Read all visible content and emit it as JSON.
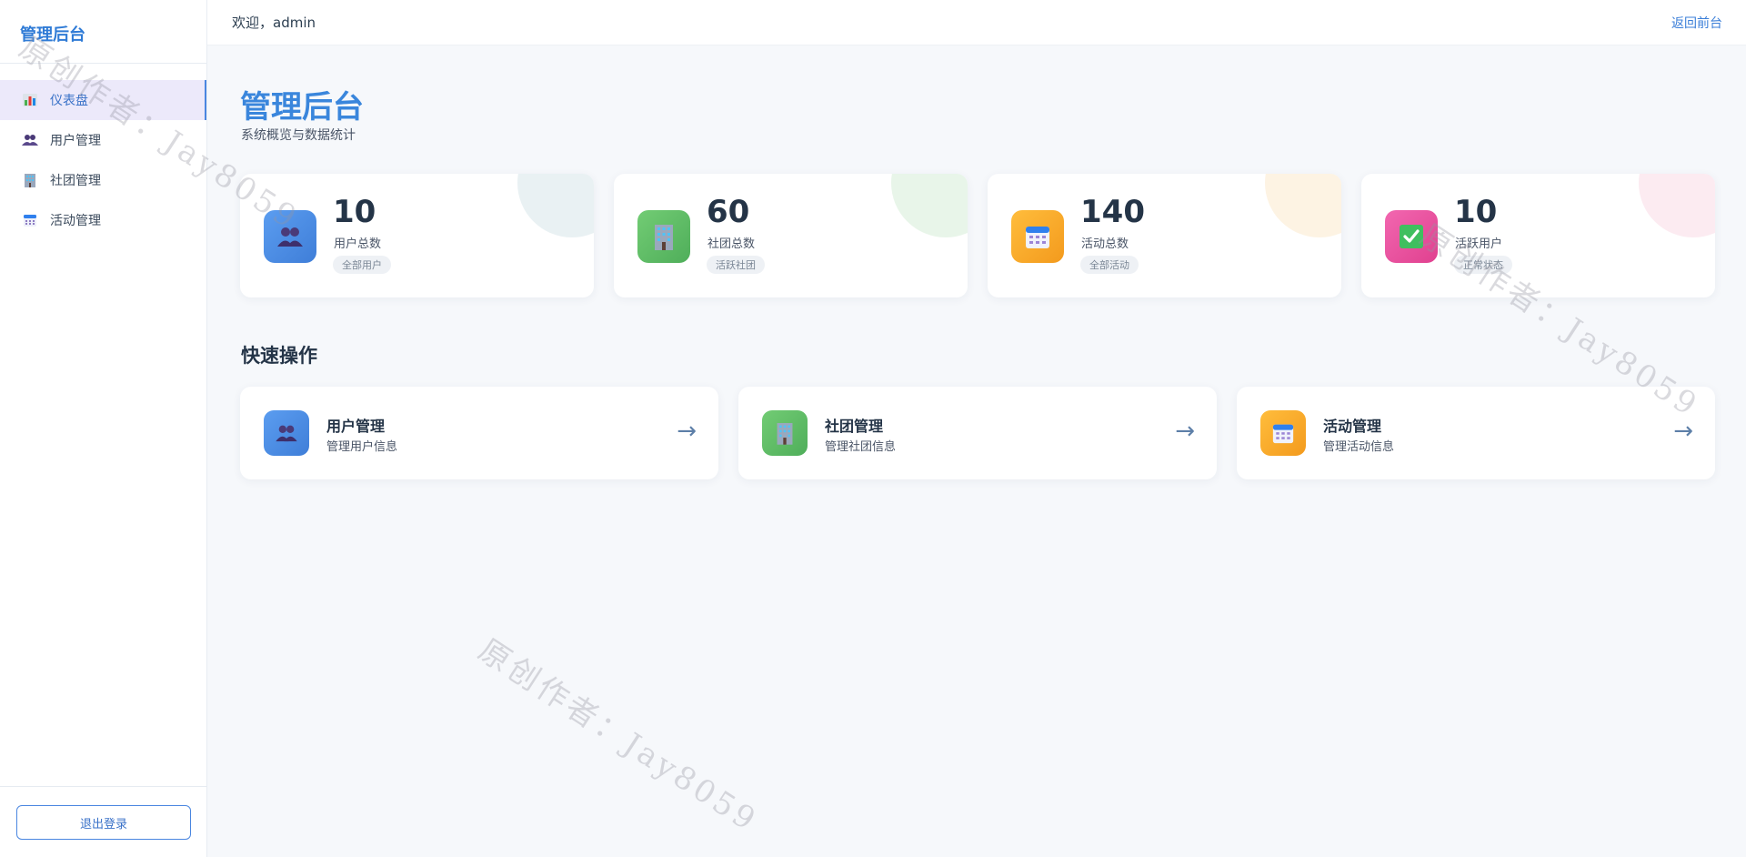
{
  "brand": "管理后台",
  "topbar": {
    "welcome": "欢迎，admin",
    "back_link": "返回前台"
  },
  "sidebar": {
    "items": [
      {
        "label": "仪表盘",
        "icon": "bar-chart-icon",
        "active": true
      },
      {
        "label": "用户管理",
        "icon": "users-icon",
        "active": false
      },
      {
        "label": "社团管理",
        "icon": "building-icon",
        "active": false
      },
      {
        "label": "活动管理",
        "icon": "calendar-icon",
        "active": false
      }
    ],
    "logout": "退出登录"
  },
  "page": {
    "title": "管理后台",
    "subtitle": "系统概览与数据统计"
  },
  "stats": [
    {
      "value": "10",
      "label": "用户总数",
      "badge": "全部用户",
      "icon": "users-icon",
      "color": "#4a8ce6",
      "deco": "#e9f1f3"
    },
    {
      "value": "60",
      "label": "社团总数",
      "badge": "活跃社团",
      "icon": "building-icon",
      "color": "#5fbe66",
      "deco": "#e8f5e9"
    },
    {
      "value": "140",
      "label": "活动总数",
      "badge": "全部活动",
      "icon": "calendar-icon",
      "color": "#f7a928",
      "deco": "#fdf3e3"
    },
    {
      "value": "10",
      "label": "活跃用户",
      "badge": "正常状态",
      "icon": "check-icon",
      "color": "#e8519c",
      "deco": "#fcebf1"
    }
  ],
  "quick_section_title": "快速操作",
  "quick": [
    {
      "title": "用户管理",
      "desc": "管理用户信息",
      "icon": "users-icon",
      "arrow": "→"
    },
    {
      "title": "社团管理",
      "desc": "管理社团信息",
      "icon": "building-icon",
      "arrow": "→"
    },
    {
      "title": "活动管理",
      "desc": "管理活动信息",
      "icon": "calendar-icon",
      "arrow": "→"
    }
  ],
  "watermark": "原创作者：Jay8059"
}
